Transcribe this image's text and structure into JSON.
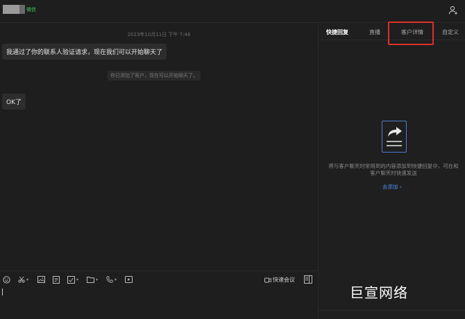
{
  "header": {
    "wechat_tag": "微信",
    "user_icon": "user-settings-icon"
  },
  "chat": {
    "timestamp": "2023年10月11日 下午 7:46",
    "messages": [
      {
        "text": "我通过了你的联系人验证请求，现在我们可以开始聊天了"
      },
      {
        "text": "OK了"
      }
    ],
    "system_message": "你已添加了客户，现在可以开始聊天了。"
  },
  "toolbar": {
    "icons": [
      "emoji-icon",
      "scissors-icon",
      "image-icon",
      "document-icon",
      "checklist-icon",
      "folder-icon",
      "phone-icon",
      "video-icon"
    ],
    "meeting_label": "快速会议"
  },
  "panel": {
    "tabs": [
      {
        "label": "快捷回复"
      },
      {
        "label": "直播"
      },
      {
        "label": "客户详情"
      },
      {
        "label": "自定义"
      }
    ],
    "active_tab": "快捷回复",
    "highlight_color": "#e0302a",
    "empty_description": "将与客户聊天时常用到的内容添加到快捷回复中，可在和客户聊天时快速发送",
    "add_link": "去添加 ›"
  },
  "watermark": "巨宣网络"
}
